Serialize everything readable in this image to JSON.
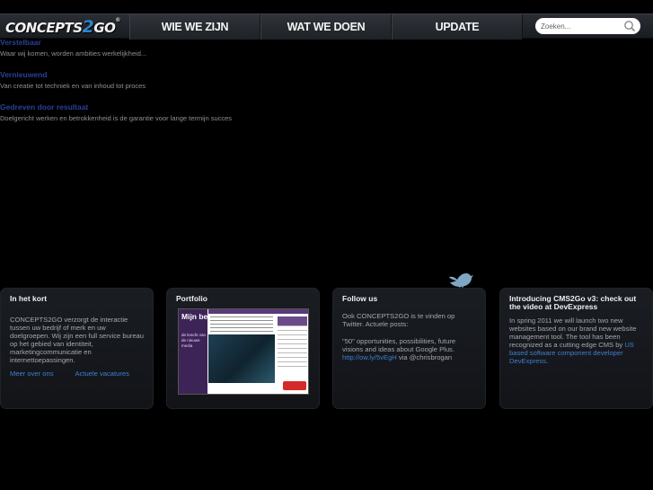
{
  "header": {
    "logo_text": "CONCEPTS",
    "logo_2": "2",
    "logo_go": "GO",
    "logo_tm": "®",
    "nav": [
      "WIE WE ZIJN",
      "WAT WE DOEN",
      "UPDATE"
    ],
    "search_placeholder": "Zoeken..."
  },
  "intro": [
    {
      "title": "Verstelbaar",
      "text": "Waar wij komen, worden ambities werkelijkheid..."
    },
    {
      "title": "Vernieuwend",
      "text": "Van creatie tot techniek en van inhoud tot proces"
    },
    {
      "title": "Gedreven door resultaat",
      "text": "Doelgericht werken en betrokkenheid is de garantie voor lange termijn succes"
    }
  ],
  "boxes": {
    "kort": {
      "title": "In het kort",
      "text": "CONCEPTS2GO verzorgt de interactie tussen uw bedrijf of merk en uw doelgroepen. Wij zijn een full service bureau op het gebied van identiteit, marketingcommunicatie en internettoepassingen.",
      "link1": "Meer over ons",
      "link2": "Actuele vacatures"
    },
    "portfolio": {
      "title": "Portfolio",
      "thumb_title": "Mijn bedrijf 2.0",
      "thumb_sub": "de kracht van de nieuwe media"
    },
    "follow": {
      "title": "Follow us",
      "text1": "Ook CONCEPTS2GO is te vinden op Twitter. Actuele posts:",
      "text2": "\"50\" opportunities, possibilities, future visions and ideas about Google Plus.",
      "tweet_link": "http://ow.ly/5vEgH",
      "tweet_via": " via @chrisbrogan"
    },
    "cms": {
      "title": "Introducing CMS2Go v3: check out the video at DevExpress",
      "text": "In spring 2011 we will launch two new websites based on our brand new website management tool. The tool has been recognized as a cutting edge CMS by ",
      "link": "US based software component developer DevExpress",
      "text_end": "."
    }
  },
  "colors": {
    "background": "#000000",
    "link": "#3f7fd0",
    "intro_title": "#2a3f9a",
    "logo_accent": "#2f86c9"
  },
  "icons": [
    "search-icon",
    "twitter-bird-icon"
  ]
}
